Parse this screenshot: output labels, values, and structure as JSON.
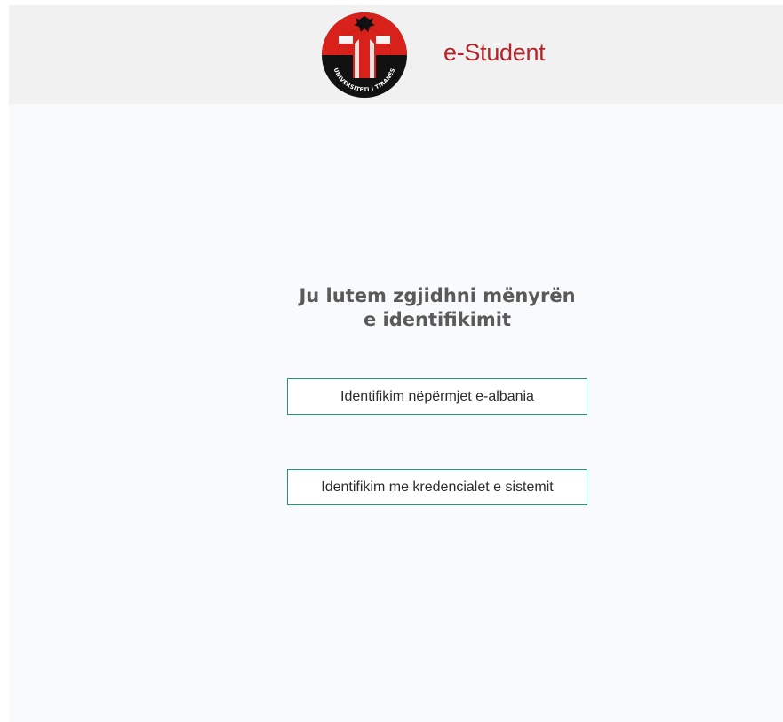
{
  "header": {
    "title": "e-Student",
    "logo_ring_text": "UNIVERSITETI I TIRANËS"
  },
  "main": {
    "heading_line1": "Ju lutem zgjidhni mënyrën",
    "heading_line2": "e identifikimit",
    "buttons": [
      {
        "label": "Identifikim nëpërmjet e-albania"
      },
      {
        "label": "Identifikim me kredencialet e sistemit"
      }
    ]
  },
  "colors": {
    "brand_red": "#b3242a",
    "button_border": "#1f9a76",
    "header_bg": "#f1f1f1",
    "page_bg": "#f9fafc",
    "heading_text": "#5a5a5a"
  }
}
